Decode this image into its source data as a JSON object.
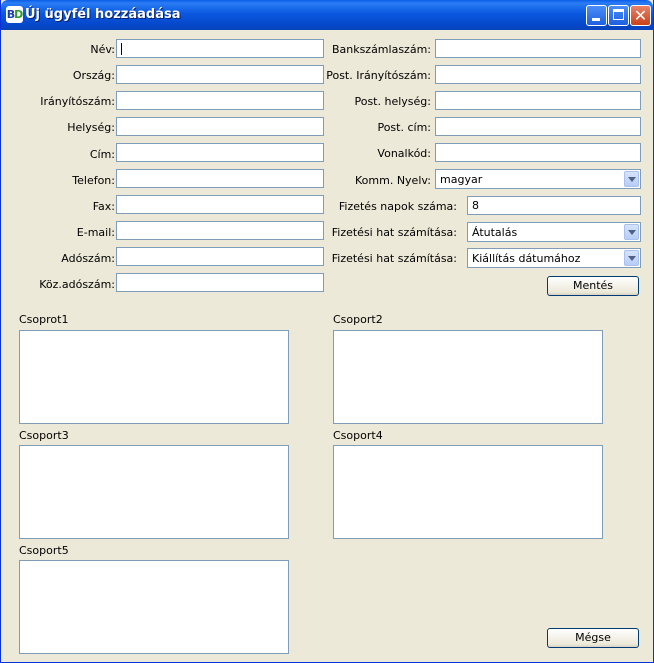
{
  "window": {
    "title": "Új ügyfél hozzáadása",
    "icon": "BD"
  },
  "left_form": [
    {
      "label": "Név:",
      "value": ""
    },
    {
      "label": "Ország:",
      "value": ""
    },
    {
      "label": "Irányítószám:",
      "value": ""
    },
    {
      "label": "Helység:",
      "value": ""
    },
    {
      "label": "Cím:",
      "value": ""
    },
    {
      "label": "Telefon:",
      "value": ""
    },
    {
      "label": "Fax:",
      "value": ""
    },
    {
      "label": "E-mail:",
      "value": ""
    },
    {
      "label": "Adószám:",
      "value": ""
    },
    {
      "label": "Köz.adószám:",
      "value": ""
    }
  ],
  "right_form": [
    {
      "label": "Bankszámlaszám:",
      "value": ""
    },
    {
      "label": "Post. Irányítószám:",
      "value": ""
    },
    {
      "label": "Post. helység:",
      "value": ""
    },
    {
      "label": "Post. cím:",
      "value": ""
    },
    {
      "label": "Vonalkód:",
      "value": ""
    }
  ],
  "comm_language": {
    "label": "Komm. Nyelv:",
    "value": "magyar"
  },
  "payment_days": {
    "label": "Fizetés napok száma:",
    "value": "8"
  },
  "payment_method": {
    "label": "Fizetési hat számítása:",
    "value": "Átutalás"
  },
  "payment_calc": {
    "label": "Fizetési hat számítása:",
    "value": "Kiállítás dátumához"
  },
  "buttons": {
    "save": "Mentés",
    "cancel": "Mégse"
  },
  "groups": [
    "Csoprot1",
    "Csoport2",
    "Csoport3",
    "Csoport4",
    "Csoport5"
  ]
}
